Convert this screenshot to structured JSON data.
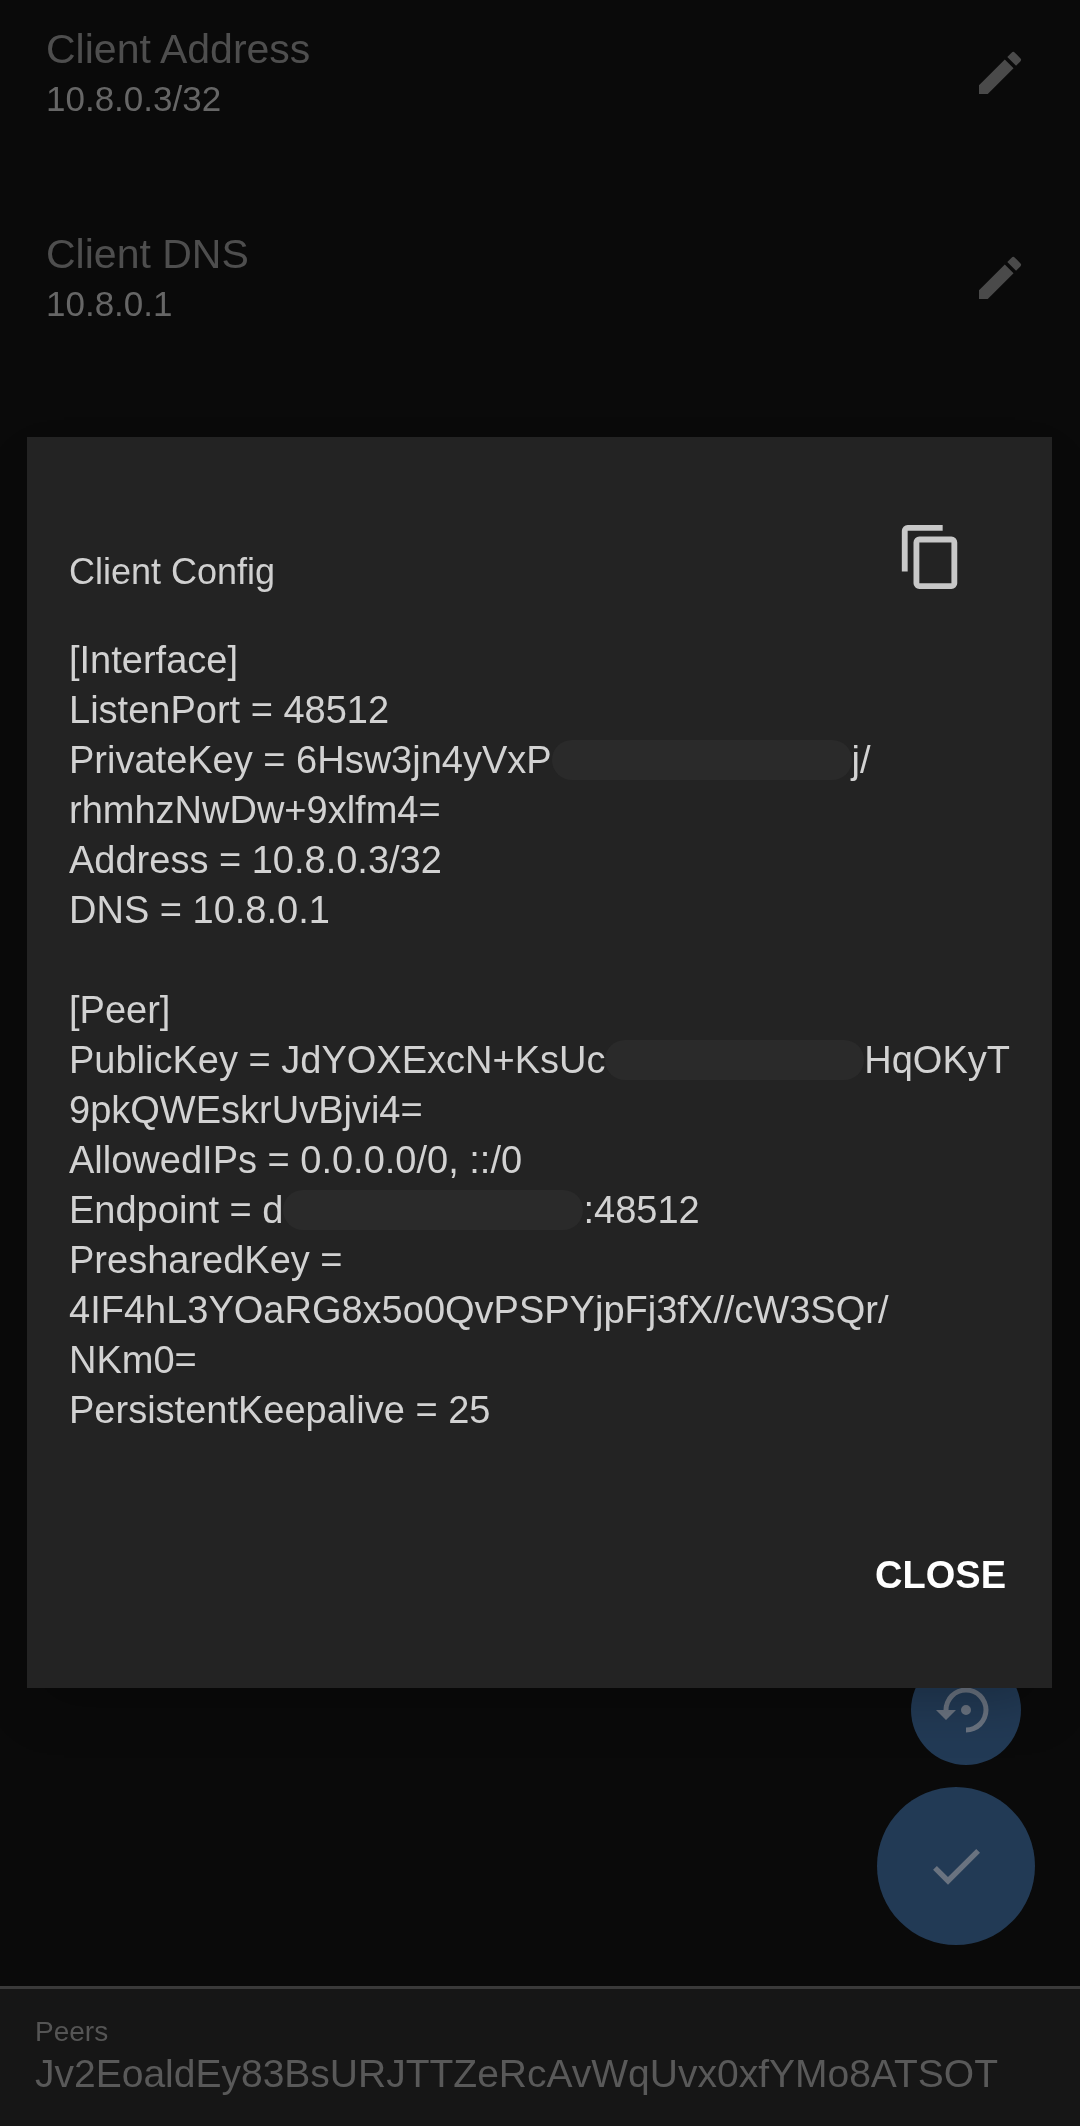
{
  "settings": [
    {
      "label": "Client Address",
      "value": "10.8.0.3/32"
    },
    {
      "label": "Client DNS",
      "value": "10.8.0.1"
    }
  ],
  "dialog": {
    "title": "Client Config",
    "sections": [
      {
        "lines": [
          {
            "text": "[Interface]"
          },
          {
            "text": "ListenPort = 48512"
          },
          {
            "text": "PrivateKey = 6Hsw3jn4yVxP",
            "after": "j/"
          },
          {
            "text": "rhmhzNwDw+9xlfm4="
          },
          {
            "text": "Address = 10.8.0.3/32"
          },
          {
            "text": "DNS = 10.8.0.1"
          }
        ]
      },
      {
        "lines": [
          {
            "text": "[Peer]"
          },
          {
            "text": "PublicKey = JdYOXExcN+KsUc",
            "after": "HqOKyT"
          },
          {
            "text": "9pkQWEskrUvBjvi4="
          },
          {
            "text": "AllowedIPs = 0.0.0.0/0, ::/0"
          },
          {
            "text": "Endpoint = d",
            "after": ":48512"
          },
          {
            "text": "PresharedKey ="
          },
          {
            "text": "4IF4hL3YOaRG8x5o0QvPSPYjpFj3fX//cW3SQr/"
          },
          {
            "text": "NKm0="
          },
          {
            "text": "PersistentKeepalive = 25"
          }
        ]
      }
    ],
    "close_button": "CLOSE"
  },
  "footer": {
    "label": "Peers",
    "value": "Jv2EoaldEy83BsURJTTZeRcAvWqUvx0xfYMo8ATSOT"
  }
}
